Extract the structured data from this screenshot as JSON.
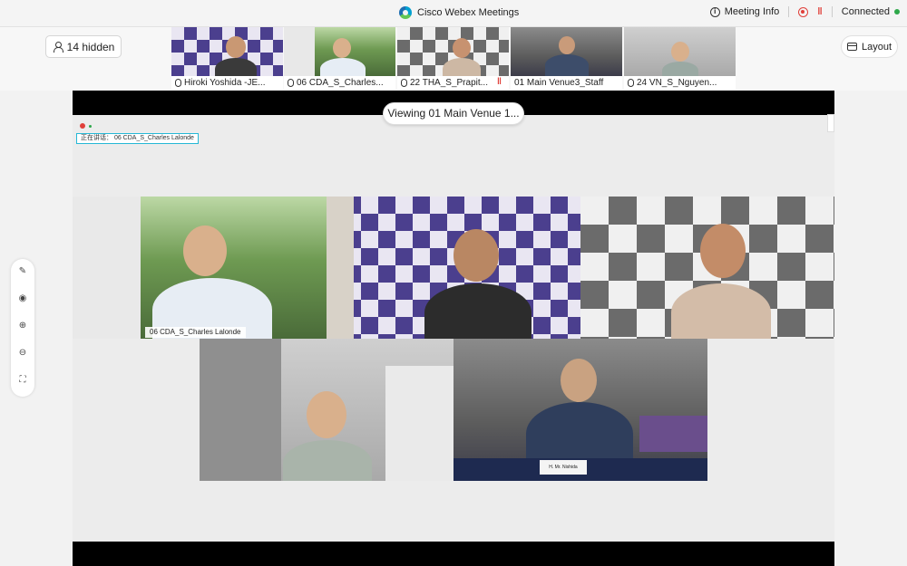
{
  "app": {
    "title": "Cisco Webex Meetings",
    "meeting_info": "Meeting Info",
    "status": "Connected"
  },
  "topbar": {
    "hidden_label": "14 hidden",
    "layout_label": "Layout",
    "thumbnails": [
      {
        "name": "Hiroki Yoshida -JE..."
      },
      {
        "name": "06 CDA_S_Charles..."
      },
      {
        "name": "22 THA_S_Prapit..."
      },
      {
        "name": "01 Main Venue3_Staff"
      },
      {
        "name": "24 VN_S_Nguyen..."
      }
    ]
  },
  "stage": {
    "viewing_label": "Viewing 01 Main Venue 1...",
    "speaker_tag": "正在讲话： 06 CDA_S_Charles Lalonde",
    "active_tile_name": "06 CDA_S_Charles Lalonde",
    "name_card": "H. Mr. Nishida"
  },
  "rail": {
    "tools": [
      "annotate-icon",
      "pointer-icon",
      "zoom-in-icon",
      "zoom-out-icon",
      "fit-icon"
    ]
  },
  "colors": {
    "accent": "#25b8d6",
    "connected": "#2ea84a",
    "alert": "#e0403a"
  }
}
